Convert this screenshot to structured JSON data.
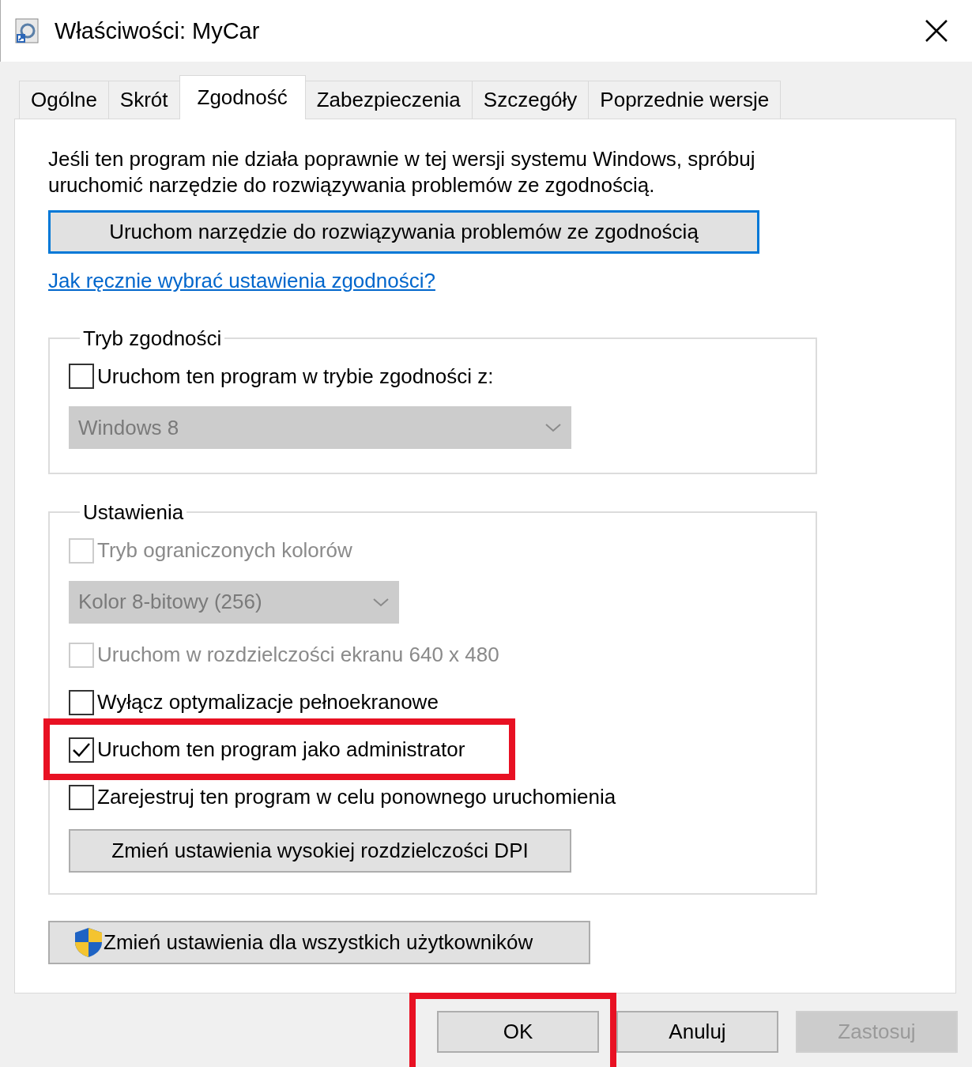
{
  "window": {
    "title": "Właściwości: MyCar"
  },
  "tabs": [
    {
      "label": "Ogólne",
      "selected": false
    },
    {
      "label": "Skrót",
      "selected": false
    },
    {
      "label": "Zgodność",
      "selected": true
    },
    {
      "label": "Zabezpieczenia",
      "selected": false
    },
    {
      "label": "Szczegóły",
      "selected": false
    },
    {
      "label": "Poprzednie wersje",
      "selected": false
    }
  ],
  "intro": "Jeśli ten program nie działa poprawnie w tej wersji systemu Windows, spróbuj uruchomić narzędzie do rozwiązywania problemów ze zgodnością.",
  "troubleshooter_button": {
    "label": "Uruchom narzędzie do rozwiązywania problemów ze zgodnością",
    "focused": true
  },
  "help_link": "Jak ręcznie wybrać ustawienia zgodności?",
  "groups": [
    {
      "title": "Tryb zgodności",
      "items": [
        {
          "kind": "checkbox",
          "label": "Uruchom ten program w trybie zgodności z:",
          "checked": false,
          "disabled": false,
          "highlighted": false
        },
        {
          "kind": "dropdown",
          "value": "Windows 8",
          "disabled": true,
          "wide": true
        }
      ]
    },
    {
      "title": "Ustawienia",
      "items": [
        {
          "kind": "checkbox",
          "label": "Tryb ograniczonych kolorów",
          "checked": false,
          "disabled": true,
          "highlighted": false
        },
        {
          "kind": "dropdown",
          "value": "Kolor 8-bitowy (256)",
          "disabled": true,
          "wide": false
        },
        {
          "kind": "checkbox",
          "label": "Uruchom w rozdzielczości ekranu 640 x 480",
          "checked": false,
          "disabled": true,
          "highlighted": false
        },
        {
          "kind": "checkbox",
          "label": "Wyłącz optymalizacje pełnoekranowe",
          "checked": false,
          "disabled": false,
          "highlighted": false
        },
        {
          "kind": "checkbox",
          "label": "Uruchom ten program jako administrator",
          "checked": true,
          "disabled": false,
          "highlighted": true
        },
        {
          "kind": "checkbox",
          "label": "Zarejestruj ten program w celu ponownego uruchomienia",
          "checked": false,
          "disabled": false,
          "highlighted": false
        },
        {
          "kind": "button",
          "label": "Zmień ustawienia wysokiej rozdzielczości DPI"
        }
      ]
    }
  ],
  "all_users_button": {
    "label": "Zmień ustawienia dla wszystkich użytkowników"
  },
  "buttons": [
    {
      "label": "OK",
      "disabled": false,
      "highlighted": true
    },
    {
      "label": "Anuluj",
      "disabled": false,
      "highlighted": false
    },
    {
      "label": "Zastosuj",
      "disabled": true,
      "highlighted": false
    }
  ]
}
